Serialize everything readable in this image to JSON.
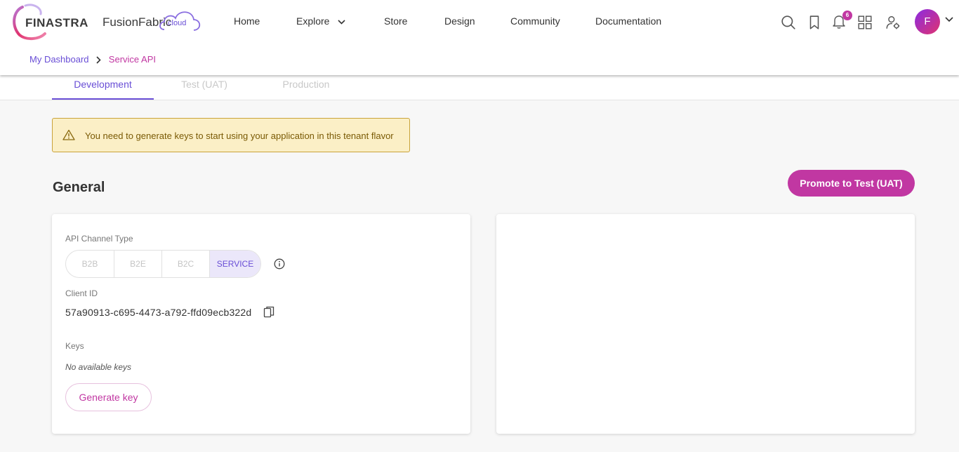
{
  "brand": {
    "finastra": "FINASTRA",
    "fusion": "FusionFabric",
    "cloud": ".cloud"
  },
  "nav": {
    "items": [
      {
        "label": "Home"
      },
      {
        "label": "Explore",
        "has_dropdown": true
      },
      {
        "label": "Store"
      },
      {
        "label": "Design"
      },
      {
        "label": "Community"
      },
      {
        "label": "Documentation"
      }
    ]
  },
  "header_icons": [
    "search-icon",
    "bookmark-icon",
    "bell-icon",
    "apps-icon",
    "user-settings-icon"
  ],
  "notifications": {
    "count": "6"
  },
  "user": {
    "initial": "F"
  },
  "breadcrumb": {
    "parent": "My Dashboard",
    "current": "Service API"
  },
  "tabs": [
    {
      "label": "Development",
      "active": true
    },
    {
      "label": "Test (UAT)",
      "active": false
    },
    {
      "label": "Production",
      "active": false
    }
  ],
  "alert": {
    "icon": "warning-icon",
    "text": "You need to generate keys to start using your application in this tenant flavor"
  },
  "general": {
    "title": "General",
    "promote_button": "Promote to Test (UAT)",
    "api_channel_label": "API Channel Type",
    "channels": [
      {
        "label": "B2B",
        "selected": false
      },
      {
        "label": "B2E",
        "selected": false
      },
      {
        "label": "B2C",
        "selected": false
      },
      {
        "label": "SERVICE",
        "selected": true
      }
    ],
    "client_id_label": "Client ID",
    "client_id": "57a90913-c695-4473-a792-ffd09ecb322d",
    "keys_label": "Keys",
    "keys_empty": "No available keys",
    "generate_button": "Generate key"
  },
  "colors": {
    "accent_purple": "#694ed6",
    "accent_magenta": "#c137a2",
    "alert_bg": "#fbefc6",
    "alert_border": "#c9a33a"
  }
}
